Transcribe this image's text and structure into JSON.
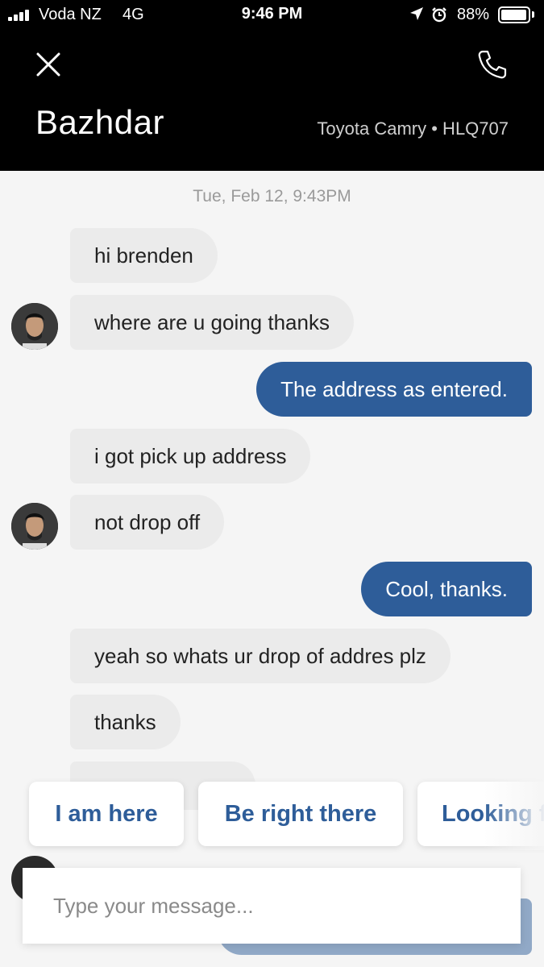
{
  "status_bar": {
    "carrier": "Voda NZ",
    "network": "4G",
    "time": "9:46 PM",
    "battery": "88%",
    "battery_level": 0.88,
    "icons": [
      "signal-icon",
      "location-arrow-icon",
      "alarm-icon",
      "battery-icon"
    ]
  },
  "header": {
    "driver_name": "Bazhdar",
    "vehicle": "Toyota Camry • HLQ707",
    "icons": [
      "close-icon",
      "phone-icon"
    ]
  },
  "chat": {
    "date": "Tue, Feb 12, 9:43PM",
    "messages": [
      {
        "from": "driver",
        "text": "hi brenden"
      },
      {
        "from": "driver",
        "text": "where are u going thanks"
      },
      {
        "from": "rider",
        "text": "The address as entered."
      },
      {
        "from": "driver",
        "text": "i got pick up address"
      },
      {
        "from": "driver",
        "text": "not drop off"
      },
      {
        "from": "rider",
        "text": "Cool, thanks."
      },
      {
        "from": "driver",
        "text": "yeah so whats ur drop of addres plz"
      },
      {
        "from": "driver",
        "text": "thanks"
      }
    ]
  },
  "quick_replies": [
    "I am here",
    "Be right there",
    "Looking f"
  ],
  "composer": {
    "placeholder": "Type your message..."
  },
  "colors": {
    "header_bg": "#000000",
    "rider_bubble": "#2e5d99",
    "driver_bubble": "#ebebeb",
    "accent": "#2e5d99"
  }
}
